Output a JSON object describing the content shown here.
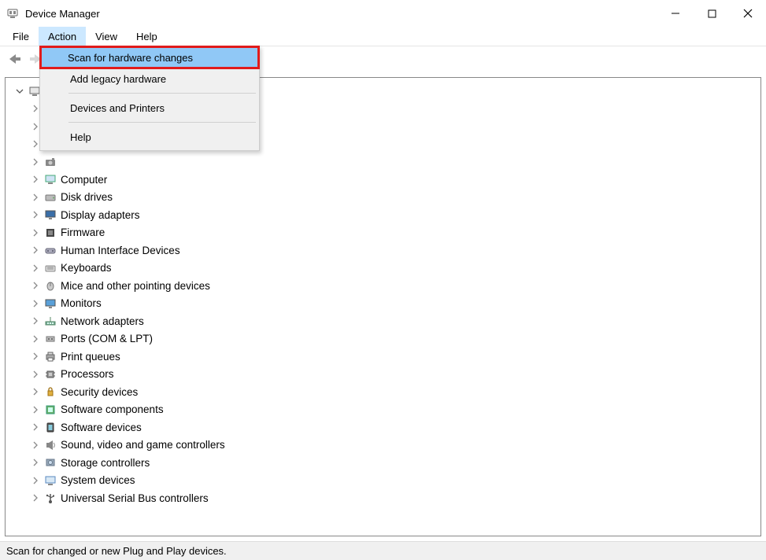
{
  "window": {
    "title": "Device Manager"
  },
  "menubar": {
    "file": "File",
    "action": "Action",
    "view": "View",
    "help": "Help"
  },
  "action_menu": {
    "scan": "Scan for hardware changes",
    "add_legacy": "Add legacy hardware",
    "devices_printers": "Devices and Printers",
    "help": "Help"
  },
  "tree": {
    "root": "",
    "items": [
      {
        "label": "",
        "icon": "audio"
      },
      {
        "label": "",
        "icon": "battery"
      },
      {
        "label": "",
        "icon": "bt"
      },
      {
        "label": "",
        "icon": "camera"
      },
      {
        "label": "Computer",
        "icon": "computer"
      },
      {
        "label": "Disk drives",
        "icon": "disk"
      },
      {
        "label": "Display adapters",
        "icon": "display"
      },
      {
        "label": "Firmware",
        "icon": "firmware"
      },
      {
        "label": "Human Interface Devices",
        "icon": "hid"
      },
      {
        "label": "Keyboards",
        "icon": "keyboard"
      },
      {
        "label": "Mice and other pointing devices",
        "icon": "mouse"
      },
      {
        "label": "Monitors",
        "icon": "monitor"
      },
      {
        "label": "Network adapters",
        "icon": "network"
      },
      {
        "label": "Ports (COM & LPT)",
        "icon": "ports"
      },
      {
        "label": "Print queues",
        "icon": "printer"
      },
      {
        "label": "Processors",
        "icon": "cpu"
      },
      {
        "label": "Security devices",
        "icon": "security"
      },
      {
        "label": "Software components",
        "icon": "swcomp"
      },
      {
        "label": "Software devices",
        "icon": "swdev"
      },
      {
        "label": "Sound, video and game controllers",
        "icon": "sound"
      },
      {
        "label": "Storage controllers",
        "icon": "storage"
      },
      {
        "label": "System devices",
        "icon": "system"
      },
      {
        "label": "Universal Serial Bus controllers",
        "icon": "usb"
      }
    ]
  },
  "statusbar": {
    "text": "Scan for changed or new Plug and Play devices."
  }
}
